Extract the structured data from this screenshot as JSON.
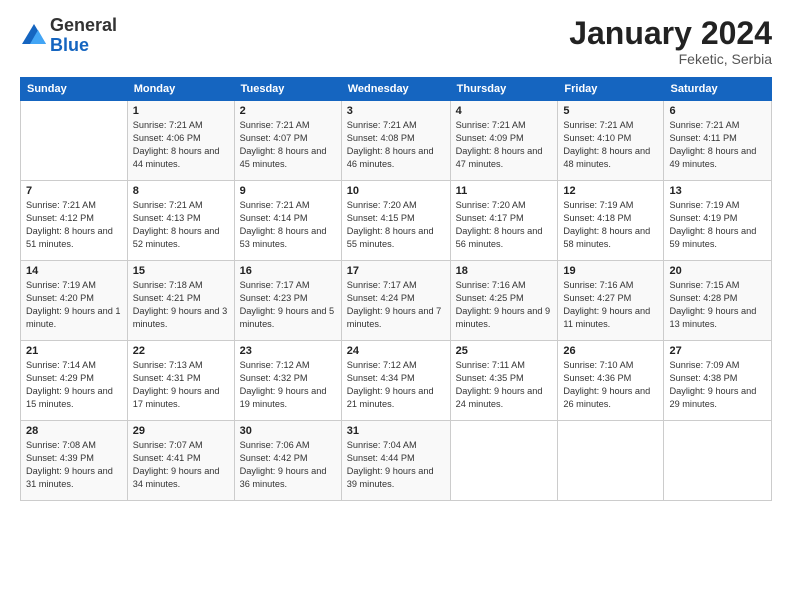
{
  "logo": {
    "general": "General",
    "blue": "Blue"
  },
  "title": "January 2024",
  "location": "Feketic, Serbia",
  "days_header": [
    "Sunday",
    "Monday",
    "Tuesday",
    "Wednesday",
    "Thursday",
    "Friday",
    "Saturday"
  ],
  "weeks": [
    [
      {
        "num": "",
        "sunrise": "",
        "sunset": "",
        "daylight": ""
      },
      {
        "num": "1",
        "sunrise": "Sunrise: 7:21 AM",
        "sunset": "Sunset: 4:06 PM",
        "daylight": "Daylight: 8 hours and 44 minutes."
      },
      {
        "num": "2",
        "sunrise": "Sunrise: 7:21 AM",
        "sunset": "Sunset: 4:07 PM",
        "daylight": "Daylight: 8 hours and 45 minutes."
      },
      {
        "num": "3",
        "sunrise": "Sunrise: 7:21 AM",
        "sunset": "Sunset: 4:08 PM",
        "daylight": "Daylight: 8 hours and 46 minutes."
      },
      {
        "num": "4",
        "sunrise": "Sunrise: 7:21 AM",
        "sunset": "Sunset: 4:09 PM",
        "daylight": "Daylight: 8 hours and 47 minutes."
      },
      {
        "num": "5",
        "sunrise": "Sunrise: 7:21 AM",
        "sunset": "Sunset: 4:10 PM",
        "daylight": "Daylight: 8 hours and 48 minutes."
      },
      {
        "num": "6",
        "sunrise": "Sunrise: 7:21 AM",
        "sunset": "Sunset: 4:11 PM",
        "daylight": "Daylight: 8 hours and 49 minutes."
      }
    ],
    [
      {
        "num": "7",
        "sunrise": "Sunrise: 7:21 AM",
        "sunset": "Sunset: 4:12 PM",
        "daylight": "Daylight: 8 hours and 51 minutes."
      },
      {
        "num": "8",
        "sunrise": "Sunrise: 7:21 AM",
        "sunset": "Sunset: 4:13 PM",
        "daylight": "Daylight: 8 hours and 52 minutes."
      },
      {
        "num": "9",
        "sunrise": "Sunrise: 7:21 AM",
        "sunset": "Sunset: 4:14 PM",
        "daylight": "Daylight: 8 hours and 53 minutes."
      },
      {
        "num": "10",
        "sunrise": "Sunrise: 7:20 AM",
        "sunset": "Sunset: 4:15 PM",
        "daylight": "Daylight: 8 hours and 55 minutes."
      },
      {
        "num": "11",
        "sunrise": "Sunrise: 7:20 AM",
        "sunset": "Sunset: 4:17 PM",
        "daylight": "Daylight: 8 hours and 56 minutes."
      },
      {
        "num": "12",
        "sunrise": "Sunrise: 7:19 AM",
        "sunset": "Sunset: 4:18 PM",
        "daylight": "Daylight: 8 hours and 58 minutes."
      },
      {
        "num": "13",
        "sunrise": "Sunrise: 7:19 AM",
        "sunset": "Sunset: 4:19 PM",
        "daylight": "Daylight: 8 hours and 59 minutes."
      }
    ],
    [
      {
        "num": "14",
        "sunrise": "Sunrise: 7:19 AM",
        "sunset": "Sunset: 4:20 PM",
        "daylight": "Daylight: 9 hours and 1 minute."
      },
      {
        "num": "15",
        "sunrise": "Sunrise: 7:18 AM",
        "sunset": "Sunset: 4:21 PM",
        "daylight": "Daylight: 9 hours and 3 minutes."
      },
      {
        "num": "16",
        "sunrise": "Sunrise: 7:17 AM",
        "sunset": "Sunset: 4:23 PM",
        "daylight": "Daylight: 9 hours and 5 minutes."
      },
      {
        "num": "17",
        "sunrise": "Sunrise: 7:17 AM",
        "sunset": "Sunset: 4:24 PM",
        "daylight": "Daylight: 9 hours and 7 minutes."
      },
      {
        "num": "18",
        "sunrise": "Sunrise: 7:16 AM",
        "sunset": "Sunset: 4:25 PM",
        "daylight": "Daylight: 9 hours and 9 minutes."
      },
      {
        "num": "19",
        "sunrise": "Sunrise: 7:16 AM",
        "sunset": "Sunset: 4:27 PM",
        "daylight": "Daylight: 9 hours and 11 minutes."
      },
      {
        "num": "20",
        "sunrise": "Sunrise: 7:15 AM",
        "sunset": "Sunset: 4:28 PM",
        "daylight": "Daylight: 9 hours and 13 minutes."
      }
    ],
    [
      {
        "num": "21",
        "sunrise": "Sunrise: 7:14 AM",
        "sunset": "Sunset: 4:29 PM",
        "daylight": "Daylight: 9 hours and 15 minutes."
      },
      {
        "num": "22",
        "sunrise": "Sunrise: 7:13 AM",
        "sunset": "Sunset: 4:31 PM",
        "daylight": "Daylight: 9 hours and 17 minutes."
      },
      {
        "num": "23",
        "sunrise": "Sunrise: 7:12 AM",
        "sunset": "Sunset: 4:32 PM",
        "daylight": "Daylight: 9 hours and 19 minutes."
      },
      {
        "num": "24",
        "sunrise": "Sunrise: 7:12 AM",
        "sunset": "Sunset: 4:34 PM",
        "daylight": "Daylight: 9 hours and 21 minutes."
      },
      {
        "num": "25",
        "sunrise": "Sunrise: 7:11 AM",
        "sunset": "Sunset: 4:35 PM",
        "daylight": "Daylight: 9 hours and 24 minutes."
      },
      {
        "num": "26",
        "sunrise": "Sunrise: 7:10 AM",
        "sunset": "Sunset: 4:36 PM",
        "daylight": "Daylight: 9 hours and 26 minutes."
      },
      {
        "num": "27",
        "sunrise": "Sunrise: 7:09 AM",
        "sunset": "Sunset: 4:38 PM",
        "daylight": "Daylight: 9 hours and 29 minutes."
      }
    ],
    [
      {
        "num": "28",
        "sunrise": "Sunrise: 7:08 AM",
        "sunset": "Sunset: 4:39 PM",
        "daylight": "Daylight: 9 hours and 31 minutes."
      },
      {
        "num": "29",
        "sunrise": "Sunrise: 7:07 AM",
        "sunset": "Sunset: 4:41 PM",
        "daylight": "Daylight: 9 hours and 34 minutes."
      },
      {
        "num": "30",
        "sunrise": "Sunrise: 7:06 AM",
        "sunset": "Sunset: 4:42 PM",
        "daylight": "Daylight: 9 hours and 36 minutes."
      },
      {
        "num": "31",
        "sunrise": "Sunrise: 7:04 AM",
        "sunset": "Sunset: 4:44 PM",
        "daylight": "Daylight: 9 hours and 39 minutes."
      },
      {
        "num": "",
        "sunrise": "",
        "sunset": "",
        "daylight": ""
      },
      {
        "num": "",
        "sunrise": "",
        "sunset": "",
        "daylight": ""
      },
      {
        "num": "",
        "sunrise": "",
        "sunset": "",
        "daylight": ""
      }
    ]
  ]
}
